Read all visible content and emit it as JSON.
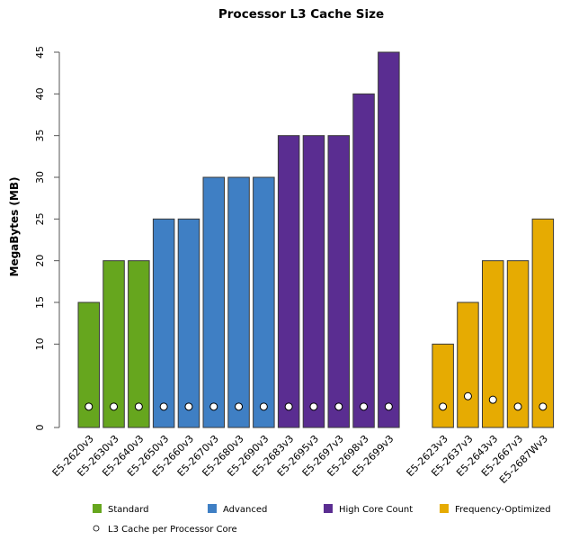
{
  "chart_data": {
    "type": "bar",
    "title": "Processor L3 Cache Size",
    "xlabel": "",
    "ylabel": "MegaBytes (MB)",
    "ylim": [
      0,
      45
    ],
    "yticks": [
      0,
      10,
      15,
      20,
      25,
      30,
      35,
      40,
      45
    ],
    "grid": false,
    "legend_position": "bottom",
    "groups": [
      {
        "name": "Standard",
        "color": "#66a61e",
        "categories": [
          "E5-2620v3",
          "E5-2630v3",
          "E5-2640v3"
        ],
        "values": [
          15,
          20,
          20
        ],
        "cache_per_core": [
          2.5,
          2.5,
          2.5
        ]
      },
      {
        "name": "Advanced",
        "color": "#3f7fc4",
        "categories": [
          "E5-2650v3",
          "E5-2660v3",
          "E5-2670v3",
          "E5-2680v3",
          "E5-2690v3"
        ],
        "values": [
          25,
          25,
          30,
          30,
          30
        ],
        "cache_per_core": [
          2.5,
          2.5,
          2.5,
          2.5,
          2.5
        ]
      },
      {
        "name": "High Core Count",
        "color": "#5a2d91",
        "categories": [
          "E5-2683v3",
          "E5-2695v3",
          "E5-2697v3",
          "E5-2698v3",
          "E5-2699v3"
        ],
        "values": [
          35,
          35,
          35,
          40,
          45
        ],
        "cache_per_core": [
          2.5,
          2.5,
          2.5,
          2.5,
          2.5
        ]
      },
      {
        "name": "Frequency-Optimized",
        "color": "#e6ab02",
        "categories": [
          "E5-2623v3",
          "E5-2637v3",
          "E5-2643v3",
          "E5-2667v3",
          "E5-2687Wv3"
        ],
        "values": [
          10,
          15,
          20,
          20,
          25
        ],
        "cache_per_core": [
          2.5,
          3.75,
          3.33,
          2.5,
          2.5
        ]
      }
    ],
    "legend": [
      {
        "label": "Standard",
        "color": "#66a61e",
        "shape": "square"
      },
      {
        "label": "Advanced",
        "color": "#3f7fc4",
        "shape": "square"
      },
      {
        "label": "High Core Count",
        "color": "#5a2d91",
        "shape": "square"
      },
      {
        "label": "Frequency-Optimized",
        "color": "#e6ab02",
        "shape": "square"
      },
      {
        "label": "L3 Cache per Processor Core",
        "color": "#ffffff",
        "shape": "circle"
      }
    ]
  }
}
